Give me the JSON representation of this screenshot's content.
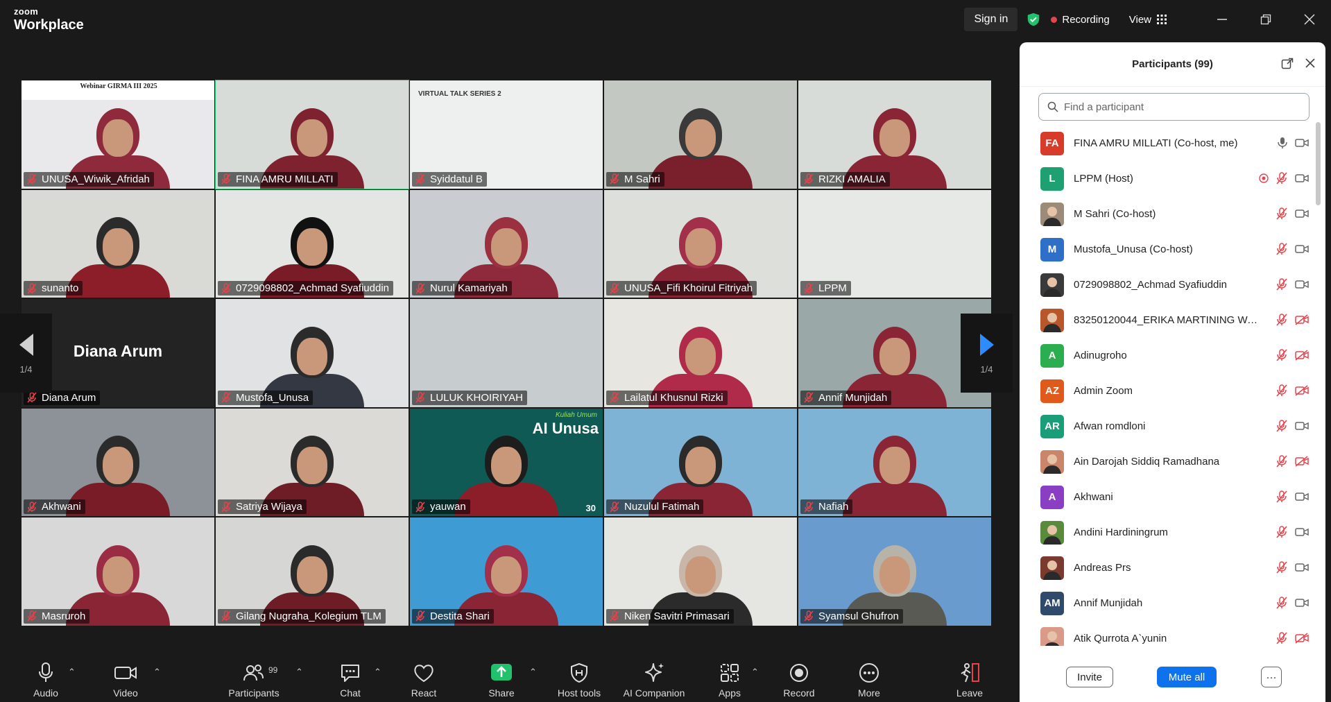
{
  "app": {
    "brand_top": "zoom",
    "brand_bottom": "Workplace"
  },
  "titlebar": {
    "signin": "Sign in",
    "recording": "Recording",
    "view": "View"
  },
  "gallery": {
    "tiles": [
      {
        "name": "UNUSA_Wiwik_Afridah",
        "bg": "#e9e9ec",
        "hijab": "#8e2a3b",
        "body": "#8e2a3b"
      },
      {
        "name": "FINA AMRU MILLATI",
        "bg": "#d7dcd9",
        "hijab": "#7e2230",
        "body": "#7e2230"
      },
      {
        "name": "Syiddatul B",
        "bg": "#eef0ef",
        "hijab": "",
        "body": ""
      },
      {
        "name": "M Sahri",
        "bg": "#c4c8c2",
        "hijab": "#3a3a3a",
        "body": "#7a1f2c"
      },
      {
        "name": "RIZKI AMALIA",
        "bg": "#d8dcd8",
        "hijab": "#8a2536",
        "body": "#8a2536"
      },
      {
        "name": "sunanto",
        "bg": "#d9dad6",
        "hijab": "#2b2b2b",
        "body": "#8c1e2a"
      },
      {
        "name": "0729098802_Achmad Syafiuddin",
        "bg": "#e4e6e3",
        "hijab": "#111111",
        "body": "#7a1b28"
      },
      {
        "name": "Nurul Kamariyah",
        "bg": "#c9cdd1",
        "hijab": "#9a3040",
        "body": "#8e2a3b"
      },
      {
        "name": "UNUSA_Fifi Khoirul Fitriyah",
        "bg": "#dcdfda",
        "hijab": "#a3304a",
        "body": "#8a2536"
      },
      {
        "name": "LPPM",
        "bg": "#e7e9e6",
        "hijab": "",
        "body": ""
      },
      {
        "name": "Diana Arum",
        "bg": "#232323",
        "hijab": "",
        "body": ""
      },
      {
        "name": "Mustofa_Unusa",
        "bg": "#e1e2e3",
        "hijab": "#2b2b2b",
        "body": "#343842"
      },
      {
        "name": "LULUK KHOIRIYAH",
        "bg": "#c7cccf",
        "hijab": "",
        "body": ""
      },
      {
        "name": "Lailatul Khusnul Rizki",
        "bg": "#e8e6e1",
        "hijab": "#b02b4a",
        "body": "#b02b4a"
      },
      {
        "name": "Annif Munjidah",
        "bg": "#9aa9a8",
        "hijab": "#8a2536",
        "body": "#8a2536"
      },
      {
        "name": "Akhwani",
        "bg": "#8c9297",
        "hijab": "#2b2b2b",
        "body": "#7a1b28"
      },
      {
        "name": "Satriya Wijaya",
        "bg": "#dcdad6",
        "hijab": "#2b2b2b",
        "body": "#6e1c26"
      },
      {
        "name": "yauwan",
        "bg": "#0f5a55",
        "hijab": "#1d1d1d",
        "body": "#8c1e2a"
      },
      {
        "name": "Nuzulul Fatimah",
        "bg": "#7fb3d6",
        "hijab": "#2b2b2b",
        "body": "#8a2536"
      },
      {
        "name": "Nafiah",
        "bg": "#7fb3d6",
        "hijab": "#8a2536",
        "body": "#8a2536"
      },
      {
        "name": "Masruroh",
        "bg": "#d8d8d8",
        "hijab": "#9a2c44",
        "body": "#8a2536"
      },
      {
        "name": "Gilang Nugraha_Kolegium TLM",
        "bg": "#d6d7d5",
        "hijab": "#2b2b2b",
        "body": "#6e1c26"
      },
      {
        "name": "Destita Shari",
        "bg": "#3f9bd4",
        "hijab": "#a3304a",
        "body": "#8a2536"
      },
      {
        "name": "Niken Savitri Primasari",
        "bg": "#e5e5e2",
        "hijab": "#c9b6a8",
        "body": "#2b2b2b"
      },
      {
        "name": "Syamsul Ghufron",
        "bg": "#6a9bcf",
        "hijab": "#b8b3a8",
        "body": "#5a5a55"
      }
    ],
    "pager_left": "1/4",
    "pager_right": "1/4",
    "tile_texts": {
      "webinar": "Webinar GIRMA III 2025",
      "vts": "VIRTUAL TALK SERIES 2",
      "ai_unusa": "AI Unusa",
      "ai_kuliah": "Kuliah Umum",
      "ai_30": "30"
    }
  },
  "participants_panel": {
    "title": "Participants (99)",
    "search_placeholder": "Find a participant",
    "items": [
      {
        "name": "FINA AMRU MILLATI (Co-host, me)",
        "initials": "FA",
        "color": "#d93b2b",
        "mic": "on",
        "video": "on",
        "photo": false
      },
      {
        "name": "LPPM (Host)",
        "initials": "L",
        "color": "#1fa070",
        "mic": "off",
        "video": "on",
        "photo": false,
        "rec": true
      },
      {
        "name": "M Sahri (Co-host)",
        "initials": "",
        "color": "#9b8b78",
        "mic": "off",
        "video": "on",
        "photo": true
      },
      {
        "name": "Mustofa_Unusa (Co-host)",
        "initials": "M",
        "color": "#2e6fc8",
        "mic": "off",
        "video": "on",
        "photo": false
      },
      {
        "name": "0729098802_Achmad Syafiuddin",
        "initials": "",
        "color": "#3a3a3a",
        "mic": "off",
        "video": "on",
        "photo": true
      },
      {
        "name": "83250120044_ERIKA MARTINING WA...",
        "initials": "",
        "color": "#b9572c",
        "mic": "off",
        "video": "off",
        "photo": true
      },
      {
        "name": "Adinugroho",
        "initials": "A",
        "color": "#2aae4f",
        "mic": "off",
        "video": "off",
        "photo": false
      },
      {
        "name": "Admin Zoom",
        "initials": "AZ",
        "color": "#e05a1c",
        "mic": "off",
        "video": "off",
        "photo": false
      },
      {
        "name": "Afwan romdloni",
        "initials": "AR",
        "color": "#1a9e7a",
        "mic": "off",
        "video": "on",
        "photo": false
      },
      {
        "name": "Ain Darojah Siddiq Ramadhana",
        "initials": "",
        "color": "#c9866a",
        "mic": "off",
        "video": "off",
        "photo": true
      },
      {
        "name": "Akhwani",
        "initials": "A",
        "color": "#8a3ec4",
        "mic": "off",
        "video": "on",
        "photo": false
      },
      {
        "name": "Andini Hardiningrum",
        "initials": "",
        "color": "#5a8a3c",
        "mic": "off",
        "video": "on",
        "photo": true
      },
      {
        "name": "Andreas Prs",
        "initials": "",
        "color": "#7a3b2e",
        "mic": "off",
        "video": "on",
        "photo": true
      },
      {
        "name": "Annif Munjidah",
        "initials": "AM",
        "color": "#2f4a6a",
        "mic": "off",
        "video": "on",
        "photo": false
      },
      {
        "name": "Atik Qurrota A`yunin",
        "initials": "",
        "color": "#d99a8a",
        "mic": "off",
        "video": "off",
        "photo": true
      }
    ],
    "invite_label": "Invite",
    "mute_all_label": "Mute all",
    "more_label": "···"
  },
  "toolbar": {
    "participants_count": "99",
    "buttons": [
      {
        "key": "audio",
        "label": "Audio"
      },
      {
        "key": "video",
        "label": "Video"
      },
      {
        "key": "participants",
        "label": "Participants"
      },
      {
        "key": "chat",
        "label": "Chat"
      },
      {
        "key": "react",
        "label": "React"
      },
      {
        "key": "share",
        "label": "Share"
      },
      {
        "key": "host_tools",
        "label": "Host tools"
      },
      {
        "key": "ai_companion",
        "label": "AI Companion"
      },
      {
        "key": "apps",
        "label": "Apps"
      },
      {
        "key": "record",
        "label": "Record"
      },
      {
        "key": "more",
        "label": "More"
      },
      {
        "key": "leave",
        "label": "Leave"
      }
    ]
  },
  "colors": {
    "accent": "#0e72ed",
    "active_speaker": "#21d07a",
    "share_green": "#21c26b",
    "muted_red": "#e8424a"
  }
}
